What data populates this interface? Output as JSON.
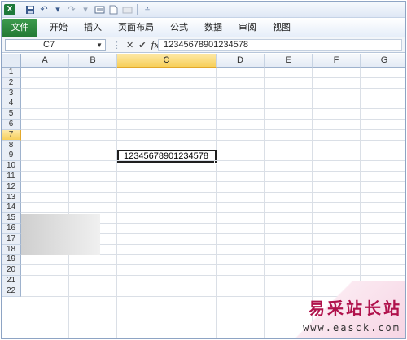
{
  "quick_access": {
    "app_icon": "excel-icon",
    "icons": [
      "save-icon",
      "undo-icon",
      "redo-icon",
      "print-preview-icon",
      "new-icon",
      "open-icon",
      "customize-dropdown-icon"
    ]
  },
  "ribbon": {
    "file_tab": "文件",
    "tabs": [
      "开始",
      "插入",
      "页面布局",
      "公式",
      "数据",
      "审阅",
      "视图"
    ]
  },
  "formula_bar": {
    "name_box": "C7",
    "fx_symbol": "fx",
    "content": "12345678901234578"
  },
  "sheet": {
    "columns": [
      "A",
      "B",
      "C",
      "D",
      "E",
      "F",
      "G"
    ],
    "rows": [
      "1",
      "2",
      "3",
      "4",
      "5",
      "6",
      "7",
      "8",
      "9",
      "10",
      "11",
      "12",
      "13",
      "14",
      "15",
      "16",
      "17",
      "18",
      "19",
      "20",
      "21",
      "22"
    ],
    "active_column": "C",
    "active_row": "7",
    "active_cell_value": "12345678901234578"
  },
  "watermark": {
    "chinese": "易采站长站",
    "url": "www.easck.com"
  },
  "colors": {
    "file_tab": "#2a8a3c",
    "active_header": "#f7cf5a",
    "watermark_text": "#b0124c"
  }
}
